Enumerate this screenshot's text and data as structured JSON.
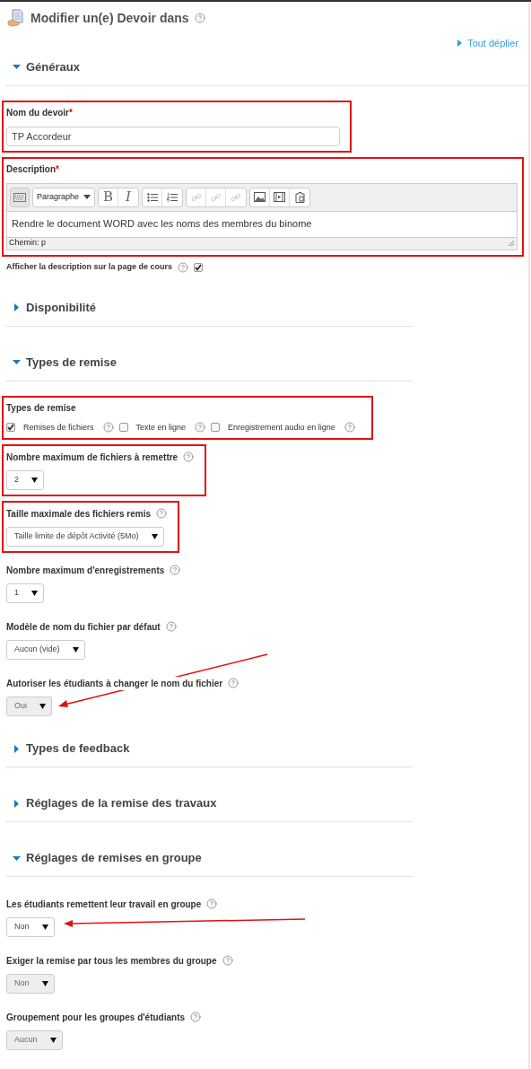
{
  "header": {
    "title": "Modifier un(e) Devoir dans",
    "expand_all": "Tout déplier"
  },
  "items": [
    {
      "kind": "section",
      "title": "Généraux",
      "expanded": true
    },
    {
      "kind": "text",
      "label": "Nom du devoir",
      "required_mark": "*",
      "highlighted": true,
      "value": "TP Accordeur"
    },
    {
      "kind": "editor",
      "label": "Description",
      "required_mark": "*",
      "highlighted": true,
      "format": "Paragraphe",
      "bold_label": "B",
      "italic_label": "I",
      "value": "Rendre le document WORD avec les noms des membres du binome",
      "path": "Chemin: p"
    },
    {
      "kind": "checkbox",
      "label": "Afficher la description sur la page de cours",
      "checked": true
    },
    {
      "kind": "section",
      "title": "Disponibilité",
      "expanded": false
    },
    {
      "kind": "section",
      "title": "Types de remise",
      "expanded": true
    },
    {
      "kind": "checkgroup",
      "label": "Types de remise",
      "highlighted": true,
      "options": [
        {
          "label": "Remises de fichiers",
          "checked": true
        },
        {
          "label": "Texte en ligne",
          "checked": false
        },
        {
          "label": "Enregistrement audio en ligne",
          "checked": false
        }
      ]
    },
    {
      "kind": "select",
      "label": "Nombre maximum de fichiers à remettre",
      "value": "2",
      "highlighted": true,
      "disabled": false
    },
    {
      "kind": "select",
      "label": "Taille maximale des fichiers remis",
      "value": "Taille limite de dépôt Activité (5Mo)",
      "highlighted": true,
      "disabled": false
    },
    {
      "kind": "select",
      "label": "Nombre maximum d'enregistrements",
      "value": "1",
      "highlighted": false,
      "disabled": false
    },
    {
      "kind": "select",
      "label": "Modèle de nom du fichier par défaut",
      "value": "Aucun (vide)",
      "highlighted": false,
      "disabled": false
    },
    {
      "kind": "select",
      "label": "Autoriser les étudiants à changer le nom du fichier",
      "value": "Oui",
      "highlighted": false,
      "disabled": true,
      "arrow": {
        "kind": "rising"
      }
    },
    {
      "kind": "section",
      "title": "Types de feedback",
      "expanded": false
    },
    {
      "kind": "section",
      "title": "Réglages de la remise des travaux",
      "expanded": false
    },
    {
      "kind": "section",
      "title": "Réglages de remises en groupe",
      "expanded": true
    },
    {
      "kind": "select",
      "label": "Les étudiants remettent leur travail en groupe",
      "value": "Non",
      "highlighted": false,
      "disabled": false,
      "arrow": {
        "kind": "level"
      }
    },
    {
      "kind": "select",
      "label": "Exiger la remise par tous les membres du groupe",
      "value": "Non",
      "highlighted": false,
      "disabled": true
    },
    {
      "kind": "select",
      "label": "Groupement pour les groupes d'étudiants",
      "value": "Aucun",
      "highlighted": false,
      "disabled": true
    }
  ]
}
